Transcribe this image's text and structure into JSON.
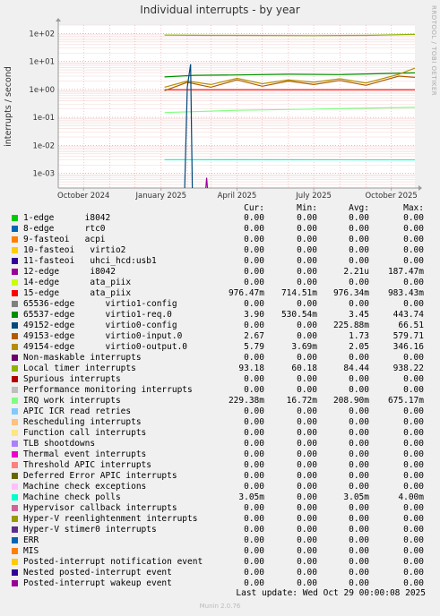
{
  "title": "Individual interrupts - by year",
  "watermark": "RRDTOOL / TOBI OETIKER",
  "footer_version": "Munin 2.0.76",
  "last_update": "Last update: Wed Oct 29 00:00:08 2025",
  "chart_data": {
    "type": "line",
    "title": "Individual interrupts - by year",
    "ylabel": "interrupts / second",
    "yscale": "log",
    "ylim": [
      0.0003,
      200
    ],
    "y_ticks": [
      "1e-03",
      "1e-02",
      "1e-01",
      "1e+00",
      "1e+01",
      "1e+02"
    ],
    "x_ticks": [
      "October 2024",
      "January 2025",
      "April 2025",
      "July 2025",
      "October 2025"
    ],
    "xlim": [
      "2024-09-01",
      "2025-10-29"
    ],
    "grid": true,
    "legend_columns": [
      "Cur:",
      "Min:",
      "Avg:",
      "Max:"
    ],
    "series": [
      {
        "name": "1-edge      i8042",
        "color": "#00cc00",
        "cur": "0.00",
        "min": "0.00",
        "avg": "0.00",
        "max": "0.00"
      },
      {
        "name": "8-edge      rtc0",
        "color": "#0066b3",
        "cur": "0.00",
        "min": "0.00",
        "avg": "0.00",
        "max": "0.00"
      },
      {
        "name": "9-fasteoi   acpi",
        "color": "#ff8000",
        "cur": "0.00",
        "min": "0.00",
        "avg": "0.00",
        "max": "0.00"
      },
      {
        "name": "10-fasteoi   virtio2",
        "color": "#ffcc00",
        "cur": "0.00",
        "min": "0.00",
        "avg": "0.00",
        "max": "0.00"
      },
      {
        "name": "11-fasteoi   uhci_hcd:usb1",
        "color": "#330099",
        "cur": "0.00",
        "min": "0.00",
        "avg": "0.00",
        "max": "0.00"
      },
      {
        "name": "12-edge      i8042",
        "color": "#990099",
        "cur": "0.00",
        "min": "0.00",
        "avg": "2.21u",
        "max": "187.47m"
      },
      {
        "name": "14-edge      ata_piix",
        "color": "#ccff00",
        "cur": "0.00",
        "min": "0.00",
        "avg": "0.00",
        "max": "0.00"
      },
      {
        "name": "15-edge      ata_piix",
        "color": "#ff0000",
        "cur": "976.47m",
        "min": "714.51m",
        "avg": "976.34m",
        "max": "983.43m"
      },
      {
        "name": "65536-edge      virtio1-config",
        "color": "#808080",
        "cur": "0.00",
        "min": "0.00",
        "avg": "0.00",
        "max": "0.00"
      },
      {
        "name": "65537-edge      virtio1-req.0",
        "color": "#008f00",
        "cur": "3.90",
        "min": "530.54m",
        "avg": "3.45",
        "max": "443.74"
      },
      {
        "name": "49152-edge      virtio0-config",
        "color": "#00487d",
        "cur": "0.00",
        "min": "0.00",
        "avg": "225.88m",
        "max": "66.51"
      },
      {
        "name": "49153-edge      virtio0-input.0",
        "color": "#b35a00",
        "cur": "2.67",
        "min": "0.00",
        "avg": "1.73",
        "max": "579.71"
      },
      {
        "name": "49154-edge      virtio0-output.0",
        "color": "#b38f00",
        "cur": "5.79",
        "min": "3.69m",
        "avg": "2.05",
        "max": "346.16"
      },
      {
        "name": "Non-maskable interrupts",
        "color": "#6b006b",
        "cur": "0.00",
        "min": "0.00",
        "avg": "0.00",
        "max": "0.00"
      },
      {
        "name": "Local timer interrupts",
        "color": "#8fb300",
        "cur": "93.18",
        "min": "60.18",
        "avg": "84.44",
        "max": "938.22"
      },
      {
        "name": "Spurious interrupts",
        "color": "#b30000",
        "cur": "0.00",
        "min": "0.00",
        "avg": "0.00",
        "max": "0.00"
      },
      {
        "name": "Performance monitoring interrupts",
        "color": "#bebebe",
        "cur": "0.00",
        "min": "0.00",
        "avg": "0.00",
        "max": "0.00"
      },
      {
        "name": "IRQ work interrupts",
        "color": "#80ff80",
        "cur": "229.38m",
        "min": "16.72m",
        "avg": "208.90m",
        "max": "675.17m"
      },
      {
        "name": "APIC ICR read retries",
        "color": "#80c9ff",
        "cur": "0.00",
        "min": "0.00",
        "avg": "0.00",
        "max": "0.00"
      },
      {
        "name": "Rescheduling interrupts",
        "color": "#ffc080",
        "cur": "0.00",
        "min": "0.00",
        "avg": "0.00",
        "max": "0.00"
      },
      {
        "name": "Function call interrupts",
        "color": "#ffe680",
        "cur": "0.00",
        "min": "0.00",
        "avg": "0.00",
        "max": "0.00"
      },
      {
        "name": "TLB shootdowns",
        "color": "#aa80ff",
        "cur": "0.00",
        "min": "0.00",
        "avg": "0.00",
        "max": "0.00"
      },
      {
        "name": "Thermal event interrupts",
        "color": "#ee00cc",
        "cur": "0.00",
        "min": "0.00",
        "avg": "0.00",
        "max": "0.00"
      },
      {
        "name": "Threshold APIC interrupts",
        "color": "#ff8080",
        "cur": "0.00",
        "min": "0.00",
        "avg": "0.00",
        "max": "0.00"
      },
      {
        "name": "Deferred Error APIC interrupts",
        "color": "#666600",
        "cur": "0.00",
        "min": "0.00",
        "avg": "0.00",
        "max": "0.00"
      },
      {
        "name": "Machine check exceptions",
        "color": "#ffbfff",
        "cur": "0.00",
        "min": "0.00",
        "avg": "0.00",
        "max": "0.00"
      },
      {
        "name": "Machine check polls",
        "color": "#00ffcc",
        "cur": "3.05m",
        "min": "0.00",
        "avg": "3.05m",
        "max": "4.00m"
      },
      {
        "name": "Hypervisor callback interrupts",
        "color": "#cc6699",
        "cur": "0.00",
        "min": "0.00",
        "avg": "0.00",
        "max": "0.00"
      },
      {
        "name": "Hyper-V reenlightenment interrupts",
        "color": "#999900",
        "cur": "0.00",
        "min": "0.00",
        "avg": "0.00",
        "max": "0.00"
      },
      {
        "name": "Hyper-V stimer0 interrupts",
        "color": "#5c2e8a",
        "cur": "0.00",
        "min": "0.00",
        "avg": "0.00",
        "max": "0.00"
      },
      {
        "name": "ERR",
        "color": "#0066b3",
        "cur": "0.00",
        "min": "0.00",
        "avg": "0.00",
        "max": "0.00"
      },
      {
        "name": "MIS",
        "color": "#ff8000",
        "cur": "0.00",
        "min": "0.00",
        "avg": "0.00",
        "max": "0.00"
      },
      {
        "name": "Posted-interrupt notification event",
        "color": "#ffcc00",
        "cur": "0.00",
        "min": "0.00",
        "avg": "0.00",
        "max": "0.00"
      },
      {
        "name": "Nested posted-interrupt event",
        "color": "#330099",
        "cur": "0.00",
        "min": "0.00",
        "avg": "0.00",
        "max": "0.00"
      },
      {
        "name": "Posted-interrupt wakeup event",
        "color": "#990099",
        "cur": "0.00",
        "min": "0.00",
        "avg": "0.00",
        "max": "0.00"
      }
    ],
    "plot_lines": [
      {
        "label": "Local timer interrupts",
        "color": "#8fb300",
        "points": [
          [
            "2025-01-05",
            88
          ],
          [
            "2025-03-01",
            86
          ],
          [
            "2025-05-01",
            85
          ],
          [
            "2025-07-01",
            84
          ],
          [
            "2025-09-01",
            86
          ],
          [
            "2025-10-29",
            93
          ]
        ]
      },
      {
        "label": "65537-edge      virtio1-req.0",
        "color": "#008f00",
        "points": [
          [
            "2025-01-05",
            2.8
          ],
          [
            "2025-02-10",
            3.2
          ],
          [
            "2025-04-01",
            3.3
          ],
          [
            "2025-06-01",
            3.5
          ],
          [
            "2025-08-01",
            3.4
          ],
          [
            "2025-10-29",
            3.9
          ]
        ]
      },
      {
        "label": "15-edge      ata_piix",
        "color": "#ff0000",
        "points": [
          [
            "2025-01-05",
            0.98
          ],
          [
            "2025-10-29",
            0.98
          ]
        ]
      },
      {
        "label": "49154-edge      virtio0-output.0",
        "color": "#b38f00",
        "points": [
          [
            "2025-01-05",
            1.2
          ],
          [
            "2025-02-01",
            2.0
          ],
          [
            "2025-03-01",
            1.5
          ],
          [
            "2025-04-01",
            2.5
          ],
          [
            "2025-05-01",
            1.6
          ],
          [
            "2025-06-01",
            2.2
          ],
          [
            "2025-07-01",
            1.8
          ],
          [
            "2025-08-01",
            2.4
          ],
          [
            "2025-09-01",
            1.7
          ],
          [
            "2025-10-10",
            3.5
          ],
          [
            "2025-10-29",
            5.8
          ]
        ]
      },
      {
        "label": "49153-edge      virtio0-input.0",
        "color": "#b35a00",
        "points": [
          [
            "2025-01-05",
            0.9
          ],
          [
            "2025-02-01",
            1.8
          ],
          [
            "2025-03-01",
            1.2
          ],
          [
            "2025-04-01",
            2.2
          ],
          [
            "2025-05-01",
            1.3
          ],
          [
            "2025-06-01",
            2.0
          ],
          [
            "2025-07-01",
            1.5
          ],
          [
            "2025-08-01",
            2.1
          ],
          [
            "2025-09-01",
            1.4
          ],
          [
            "2025-10-10",
            3.0
          ],
          [
            "2025-10-29",
            2.7
          ]
        ]
      },
      {
        "label": "IRQ work interrupts",
        "color": "#80ff80",
        "points": [
          [
            "2025-01-05",
            0.15
          ],
          [
            "2025-04-01",
            0.18
          ],
          [
            "2025-07-01",
            0.2
          ],
          [
            "2025-10-29",
            0.23
          ]
        ]
      },
      {
        "label": "Machine check polls",
        "color": "#00ffcc",
        "points": [
          [
            "2025-01-05",
            0.0031
          ],
          [
            "2025-10-29",
            0.00305
          ]
        ]
      },
      {
        "label": "49152-edge      virtio0-config",
        "color": "#00487d",
        "points": [
          [
            "2025-01-29",
            0.0003
          ],
          [
            "2025-02-01",
            1.2
          ],
          [
            "2025-02-05",
            8
          ],
          [
            "2025-02-07",
            0.0003
          ]
        ]
      },
      {
        "label": "12-edge      i8042",
        "color": "#990099",
        "points": [
          [
            "2025-02-23",
            0.0003
          ],
          [
            "2025-02-24",
            0.0007
          ],
          [
            "2025-02-25",
            0.0003
          ]
        ]
      }
    ]
  }
}
